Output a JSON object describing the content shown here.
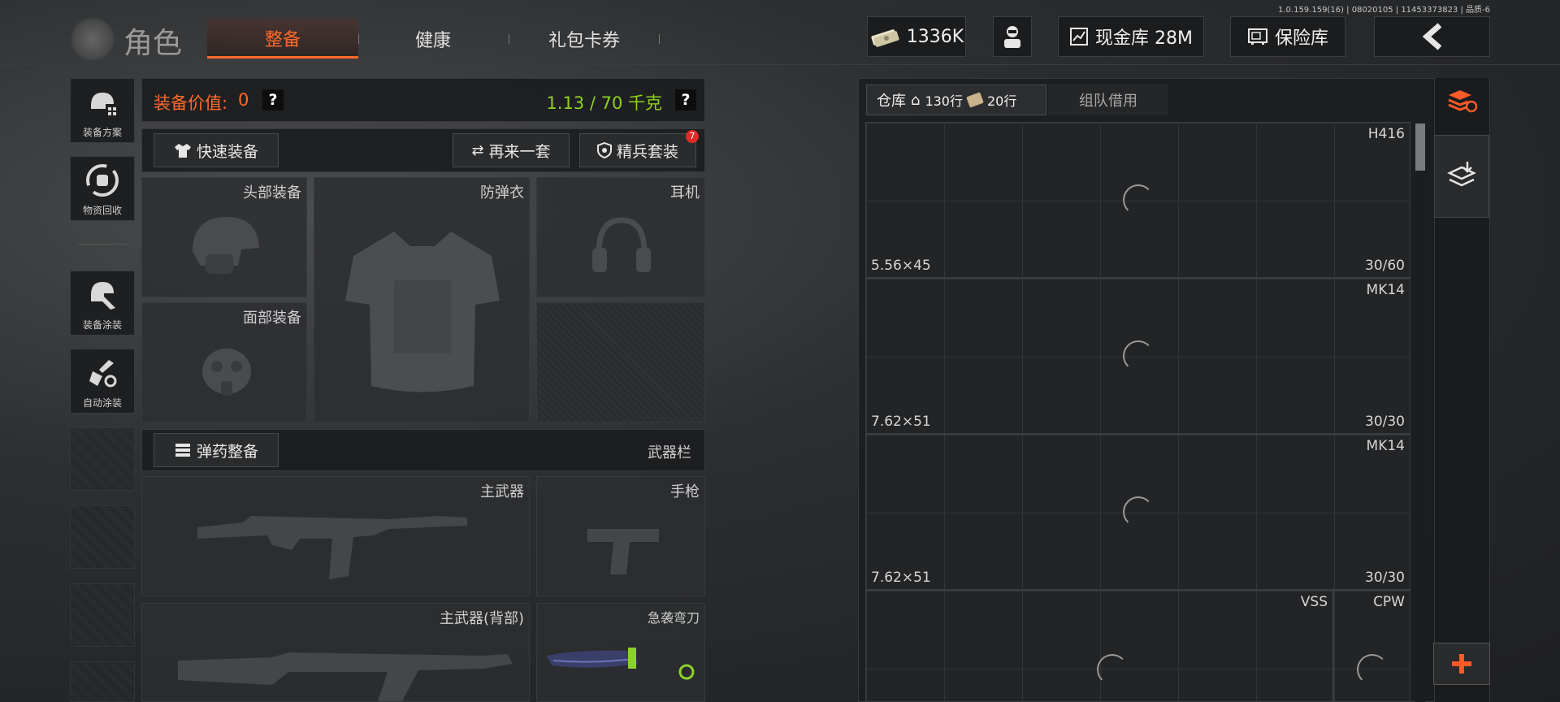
{
  "version": "1.0.159.159(16) | 08020105 | 11453373823 | 品质-6",
  "header": {
    "title": "角色",
    "tabs": [
      {
        "label": "整备",
        "active": true
      },
      {
        "label": "健康",
        "active": false
      },
      {
        "label": "礼包卡券",
        "active": false
      }
    ],
    "currency": "1336K",
    "cash_vault": "现金库 28M",
    "insurance_vault": "保险库"
  },
  "sidebar": {
    "items": [
      {
        "label": "装备方案",
        "icon": "loadout-helmet-icon"
      },
      {
        "label": "物资回收",
        "icon": "recycle-icon"
      },
      {
        "label": "装备涂装",
        "icon": "skin-paint-icon"
      },
      {
        "label": "自动涂装",
        "icon": "auto-paint-icon"
      }
    ]
  },
  "loadout": {
    "value_label": "装备价值:",
    "value": "0",
    "weight": "1.13 / 70 千克",
    "help": "?",
    "quick_equip": "快速装备",
    "again": "再来一套",
    "elite_kit": "精兵套装",
    "elite_badge": "7",
    "slots": {
      "head": "头部装备",
      "armor": "防弹衣",
      "headset": "耳机",
      "face": "面部装备"
    },
    "ammo_button": "弹药整备",
    "weapon_bar": "武器栏",
    "weapons": {
      "primary": "主武器",
      "pistol": "手枪",
      "primary_back": "主武器(背部)",
      "melee": "急袭弯刀"
    }
  },
  "warehouse": {
    "tab_label": "仓库",
    "rows_home": "130行",
    "rows_ticket": "20行",
    "team_borrow": "组队借用",
    "items": [
      {
        "name": "H416",
        "ammo": "5.56×45",
        "capacity": "30/60"
      },
      {
        "name": "MK14",
        "ammo": "7.62×51",
        "capacity": "30/30"
      },
      {
        "name": "MK14",
        "ammo": "7.62×51",
        "capacity": "30/30"
      },
      {
        "name": "VSS",
        "ammo": "",
        "capacity": ""
      },
      {
        "name": "CPW",
        "ammo": "",
        "capacity": ""
      }
    ]
  },
  "colors": {
    "accent": "#ff6a2a",
    "weight_green": "#8fd11f",
    "badge_red": "#e02a2a"
  }
}
